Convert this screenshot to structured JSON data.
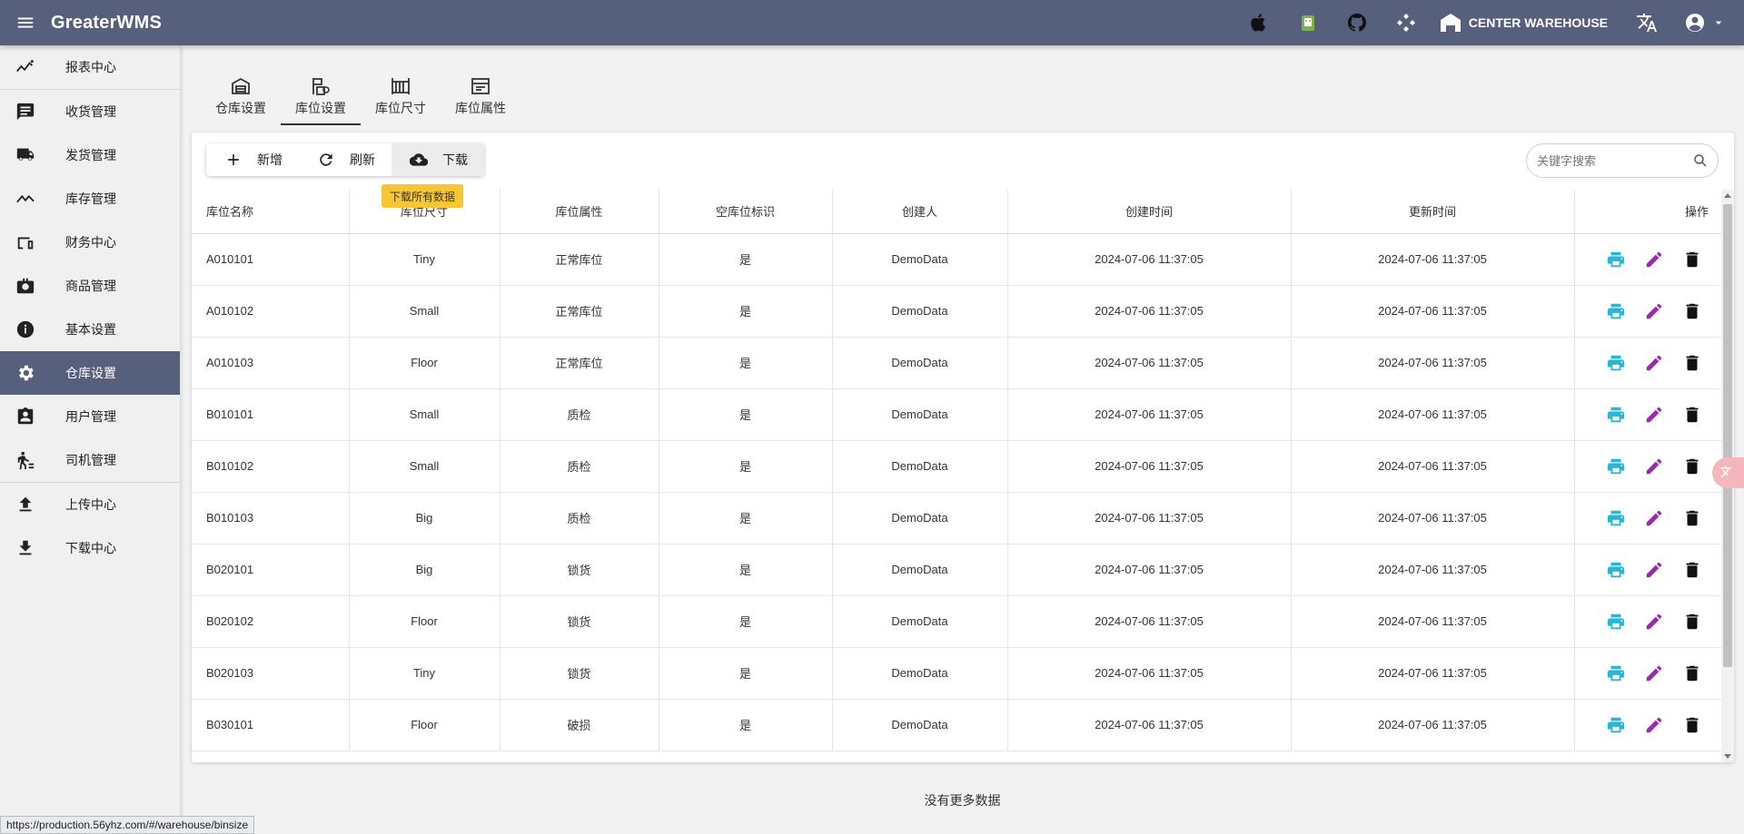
{
  "header": {
    "title": "GreaterWMS",
    "warehouse": "CENTER WAREHOUSE",
    "icons": [
      "apple-icon",
      "android-icon",
      "github-icon",
      "api-icon",
      "warehouse-icon",
      "translate-icon",
      "account-icon",
      "caret-down-icon"
    ]
  },
  "sidebar": {
    "items": [
      {
        "label": "报表中心",
        "icon": "chart-icon"
      },
      {
        "label": "收货管理",
        "icon": "message-list-icon"
      },
      {
        "label": "发货管理",
        "icon": "truck-icon"
      },
      {
        "label": "库存管理",
        "icon": "trend-icon"
      },
      {
        "label": "财务中心",
        "icon": "devices-icon"
      },
      {
        "label": "商品管理",
        "icon": "briefcase-icon"
      },
      {
        "label": "基本设置",
        "icon": "info-icon"
      },
      {
        "label": "仓库设置",
        "icon": "gear-icon"
      },
      {
        "label": "用户管理",
        "icon": "contact-icon"
      },
      {
        "label": "司机管理",
        "icon": "walker-icon"
      },
      {
        "label": "上传中心",
        "icon": "upload-icon"
      },
      {
        "label": "下载中心",
        "icon": "download-icon"
      }
    ]
  },
  "tabs": [
    {
      "label": "仓库设置"
    },
    {
      "label": "库位设置"
    },
    {
      "label": "库位尺寸"
    },
    {
      "label": "库位属性"
    }
  ],
  "toolbar": {
    "add_label": "新增",
    "refresh_label": "刷新",
    "download_label": "下载",
    "tooltip": "下载所有数据"
  },
  "search": {
    "placeholder": "关键字搜索"
  },
  "table": {
    "columns": [
      "库位名称",
      "库位尺寸",
      "库位属性",
      "空库位标识",
      "创建人",
      "创建时间",
      "更新时间",
      "操作"
    ],
    "rows": [
      [
        "A010101",
        "Tiny",
        "正常库位",
        "是",
        "DemoData",
        "2024-07-06 11:37:05",
        "2024-07-06 11:37:05"
      ],
      [
        "A010102",
        "Small",
        "正常库位",
        "是",
        "DemoData",
        "2024-07-06 11:37:05",
        "2024-07-06 11:37:05"
      ],
      [
        "A010103",
        "Floor",
        "正常库位",
        "是",
        "DemoData",
        "2024-07-06 11:37:05",
        "2024-07-06 11:37:05"
      ],
      [
        "B010101",
        "Small",
        "质检",
        "是",
        "DemoData",
        "2024-07-06 11:37:05",
        "2024-07-06 11:37:05"
      ],
      [
        "B010102",
        "Small",
        "质检",
        "是",
        "DemoData",
        "2024-07-06 11:37:05",
        "2024-07-06 11:37:05"
      ],
      [
        "B010103",
        "Big",
        "质检",
        "是",
        "DemoData",
        "2024-07-06 11:37:05",
        "2024-07-06 11:37:05"
      ],
      [
        "B020101",
        "Big",
        "锁货",
        "是",
        "DemoData",
        "2024-07-06 11:37:05",
        "2024-07-06 11:37:05"
      ],
      [
        "B020102",
        "Floor",
        "锁货",
        "是",
        "DemoData",
        "2024-07-06 11:37:05",
        "2024-07-06 11:37:05"
      ],
      [
        "B020103",
        "Tiny",
        "锁货",
        "是",
        "DemoData",
        "2024-07-06 11:37:05",
        "2024-07-06 11:37:05"
      ],
      [
        "B030101",
        "Floor",
        "破损",
        "是",
        "DemoData",
        "2024-07-06 11:37:05",
        "2024-07-06 11:37:05"
      ]
    ]
  },
  "footer": {
    "no_more": "没有更多数据",
    "status_url": "https://production.56yhz.com/#/warehouse/binsize"
  },
  "colors": {
    "header_bg": "#56607c",
    "print": "#29b6d6",
    "edit": "#9c27b0",
    "delete": "#111111",
    "tooltip": "#f7c634"
  }
}
